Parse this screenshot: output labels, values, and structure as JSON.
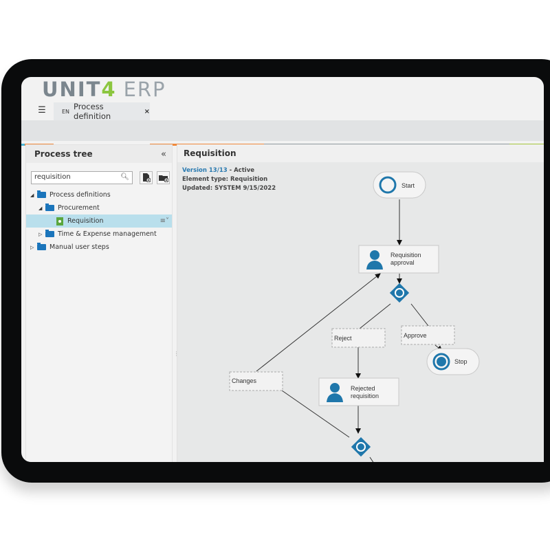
{
  "app": {
    "logo_brand": "UNIT",
    "logo_four": "4",
    "logo_product": "ERP",
    "colors": {
      "accent_orange": "#f0883a",
      "accent_green": "#a4c639",
      "accent_blue": "#4cb6d8",
      "gray_bar": "#8e979d",
      "diagram_blue": "#1f77ab"
    }
  },
  "tabbar": {
    "menu_icon": "list-icon",
    "active_tab": {
      "lang": "EN",
      "title": "Process definition",
      "close": "×"
    }
  },
  "left_panel": {
    "title": "Process tree",
    "collapse_icon": "«",
    "search": {
      "value": "requisition",
      "icon": "search-icon"
    },
    "buttons": [
      {
        "name": "add-process-button",
        "icon": "file-add-icon"
      },
      {
        "name": "add-folder-button",
        "icon": "folder-add-icon"
      }
    ],
    "tree": [
      {
        "label": "Process definitions",
        "level": 0,
        "expanded": true,
        "type": "folder"
      },
      {
        "label": "Procurement",
        "level": 1,
        "expanded": true,
        "type": "folder"
      },
      {
        "label": "Requisition",
        "level": 2,
        "type": "process",
        "selected": true
      },
      {
        "label": "Time & Expense management",
        "level": 1,
        "expanded": false,
        "type": "folder"
      },
      {
        "label": "Manual user steps",
        "level": 0,
        "expanded": false,
        "type": "folder"
      }
    ],
    "row_menu_icon": "≡˅"
  },
  "right_panel": {
    "title": "Requisition",
    "version_link": "Version 13/13",
    "version_status": " - Active",
    "element_type": "Element type: Requisition",
    "updated": "Updated: SYSTEM 9/15/2022"
  },
  "diagram": {
    "nodes": {
      "start": "Start",
      "approval_l1": "Requisition",
      "approval_l2": "approval",
      "reject": "Reject",
      "approve": "Approve",
      "stop": "Stop",
      "changes": "Changes",
      "rejected_l1": "Rejected",
      "rejected_l2": "requisition"
    }
  }
}
